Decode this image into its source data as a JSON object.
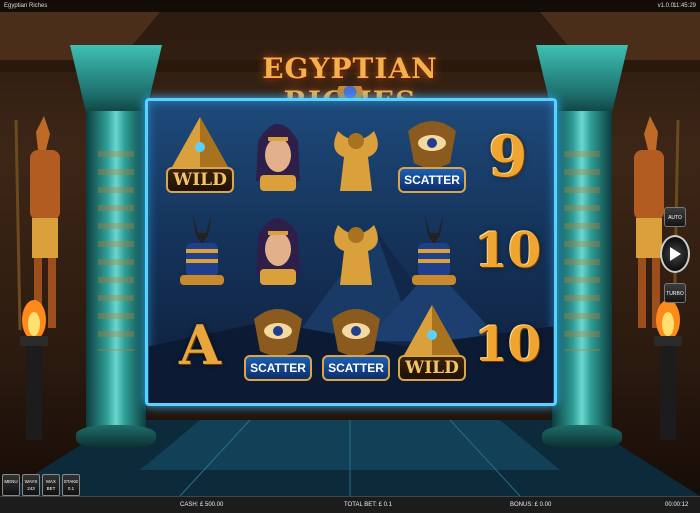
{
  "window": {
    "title": "Egyptian Riches",
    "version": "v1.0.0",
    "clock": "11:45:29"
  },
  "logo": {
    "text": "EGYPTIAN RICHES"
  },
  "reels": [
    [
      "wild-pyramid",
      "anubis",
      "letter-a"
    ],
    [
      "cleopatra",
      "cleopatra",
      "scatter-eye"
    ],
    [
      "sphinx",
      "sphinx",
      "scatter-eye"
    ],
    [
      "scatter-eye",
      "anubis",
      "wild-pyramid"
    ],
    [
      "number-9",
      "number-10",
      "number-10"
    ]
  ],
  "labels": {
    "wild": "WILD",
    "scatter": "SCATTER",
    "letter_a": "A",
    "nine": "9",
    "ten": "10"
  },
  "side_controls": {
    "auto": "AUTO",
    "turbo": "TURBO"
  },
  "bottom_buttons": [
    {
      "label": "MENU",
      "value": ""
    },
    {
      "label": "WAYS",
      "value": "243"
    },
    {
      "label": "MAX BET",
      "value": ""
    },
    {
      "label": "STAKE",
      "value": "0.1"
    }
  ],
  "status": {
    "cash": "CASH: £ 500.00",
    "total_bet": "TOTAL BET: £ 0.1",
    "bonus": "BONUS: £ 0.00",
    "timer": "00:00:12"
  },
  "colors": {
    "gold": "#f0a530",
    "frame": "#5ad2ff",
    "scatter": "#1c5fb4",
    "pillar": "#2f9d96"
  }
}
